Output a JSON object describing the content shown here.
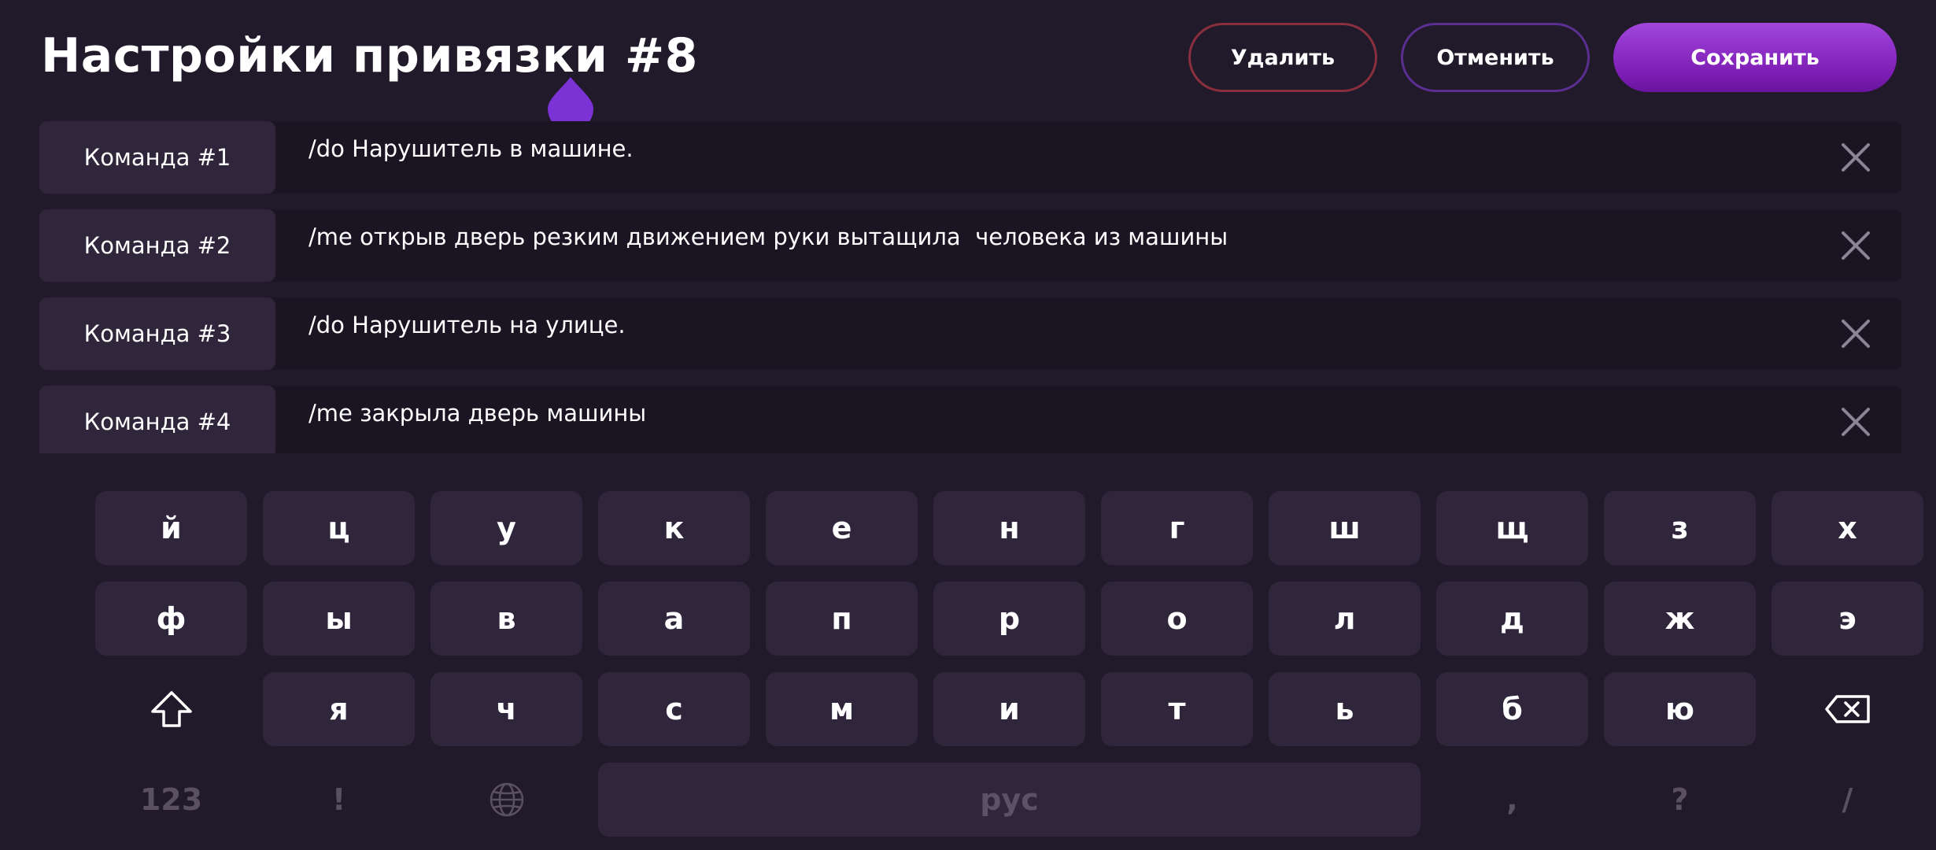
{
  "header": {
    "title": "Настройки привязки #8",
    "delete_label": "Удалить",
    "cancel_label": "Отменить",
    "save_label": "Сохранить"
  },
  "commands": [
    {
      "label": "Команда #1",
      "text": "/do Нарушитель в машине."
    },
    {
      "label": "Команда #2",
      "text": "/me открыв дверь резким движением руки вытащила  человека из машины"
    },
    {
      "label": "Команда #3",
      "text": "/do Нарушитель на улице."
    },
    {
      "label": "Команда #4",
      "text": "/me закрыла дверь машины"
    }
  ],
  "keyboard": {
    "row1": [
      "й",
      "ц",
      "у",
      "к",
      "е",
      "н",
      "г",
      "ш",
      "щ",
      "з",
      "х"
    ],
    "row2": [
      "ф",
      "ы",
      "в",
      "а",
      "п",
      "р",
      "о",
      "л",
      "д",
      "ж",
      "э"
    ],
    "row3": [
      "я",
      "ч",
      "с",
      "м",
      "и",
      "т",
      "ь",
      "б",
      "ю"
    ],
    "numbers_label": "123",
    "exclaim_label": "!",
    "space_label": "рус",
    "comma_label": ",",
    "question_label": "?",
    "slash_label": "/",
    "icons": {
      "shift": "shift-arrow-icon",
      "backspace": "backspace-icon",
      "language": "globe-icon",
      "remove": "close-x-icon"
    }
  },
  "colors": {
    "background": "#211a2b",
    "key": "#2f263b",
    "accent": "#8a2be2",
    "delete_border": "#8a2f3e",
    "cancel_border": "#5b2f8f"
  }
}
